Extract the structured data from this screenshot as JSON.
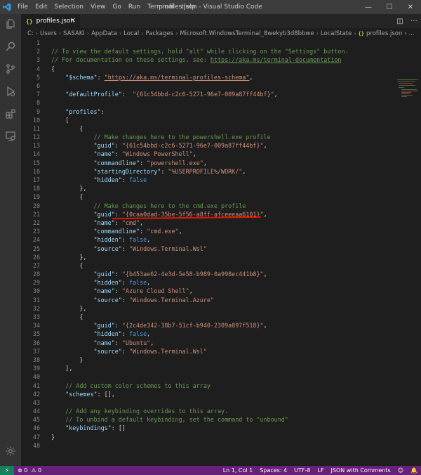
{
  "titlebar": {
    "menu": [
      "File",
      "Edit",
      "Selection",
      "View",
      "Go",
      "Run",
      "Terminal",
      "Help"
    ],
    "title": "profiles.json - Visual Studio Code",
    "minimize": "—",
    "maximize": "☐",
    "close": "✕"
  },
  "tab": {
    "icon": "{}",
    "label": "profiles.json",
    "close": "✕"
  },
  "editor_actions": {
    "split": "◫",
    "more": "···"
  },
  "breadcrumb": {
    "sep": "›",
    "items": [
      "C:",
      "Users",
      "SASAKI",
      "AppData",
      "Local",
      "Packages",
      "Microsoft.WindowsTerminal_8wekyb3d8bbwe",
      "LocalState"
    ],
    "file_icon": "{}",
    "file": "profiles.json",
    "trail": "› ..."
  },
  "code_lines": [
    {
      "n": "1",
      "segs": [
        {
          "t": "",
          "c": "c-punc"
        }
      ]
    },
    {
      "n": "2",
      "segs": [
        {
          "t": "// To view the default settings, hold \"alt\" while clicking on the \"Settings\" button.",
          "c": "c-comment"
        }
      ]
    },
    {
      "n": "3",
      "segs": [
        {
          "t": "// For documentation on these settings, see: ",
          "c": "c-comment"
        },
        {
          "t": "https://aka.ms/terminal-documentation",
          "c": "c-comment c-link"
        }
      ]
    },
    {
      "n": "4",
      "segs": [
        {
          "t": "{",
          "c": "c-punc"
        }
      ]
    },
    {
      "n": "5",
      "segs": [
        {
          "t": "    ",
          "c": "c-punc"
        },
        {
          "t": "\"$schema\"",
          "c": "c-key"
        },
        {
          "t": ": ",
          "c": "c-punc"
        },
        {
          "t": "\"https://aka.ms/terminal-profiles-schema\"",
          "c": "c-str c-link"
        },
        {
          "t": ",",
          "c": "c-punc"
        }
      ]
    },
    {
      "n": "6",
      "segs": [
        {
          "t": "",
          "c": "c-punc"
        }
      ]
    },
    {
      "n": "7",
      "segs": [
        {
          "t": "    ",
          "c": "c-punc"
        },
        {
          "t": "\"defaultProfile\"",
          "c": "c-key"
        },
        {
          "t": ":  ",
          "c": "c-punc"
        },
        {
          "t": "\"{61c54bbd-c2c6-5271-96e7-009a87ff44bf}\"",
          "c": "c-str"
        },
        {
          "t": ",",
          "c": "c-punc"
        }
      ]
    },
    {
      "n": "8",
      "segs": [
        {
          "t": "",
          "c": "c-punc"
        }
      ]
    },
    {
      "n": "9",
      "segs": [
        {
          "t": "    ",
          "c": "c-punc"
        },
        {
          "t": "\"profiles\"",
          "c": "c-key"
        },
        {
          "t": ":",
          "c": "c-punc"
        }
      ]
    },
    {
      "n": "10",
      "segs": [
        {
          "t": "    [",
          "c": "c-punc"
        }
      ]
    },
    {
      "n": "11",
      "segs": [
        {
          "t": "        {",
          "c": "c-punc"
        }
      ]
    },
    {
      "n": "12",
      "segs": [
        {
          "t": "            // Make changes here to the powershell.exe profile",
          "c": "c-comment"
        }
      ]
    },
    {
      "n": "13",
      "segs": [
        {
          "t": "            ",
          "c": "c-punc"
        },
        {
          "t": "\"guid\"",
          "c": "c-key"
        },
        {
          "t": ": ",
          "c": "c-punc"
        },
        {
          "t": "\"{61c54bbd-c2c6-5271-96e7-009a87ff44bf}\"",
          "c": "c-str"
        },
        {
          "t": ",",
          "c": "c-punc"
        }
      ]
    },
    {
      "n": "14",
      "segs": [
        {
          "t": "            ",
          "c": "c-punc"
        },
        {
          "t": "\"name\"",
          "c": "c-key"
        },
        {
          "t": ": ",
          "c": "c-punc"
        },
        {
          "t": "\"Windows PowerShell\"",
          "c": "c-str"
        },
        {
          "t": ",",
          "c": "c-punc"
        }
      ]
    },
    {
      "n": "15",
      "segs": [
        {
          "t": "            ",
          "c": "c-punc"
        },
        {
          "t": "\"commandline\"",
          "c": "c-key"
        },
        {
          "t": ": ",
          "c": "c-punc"
        },
        {
          "t": "\"powershell.exe\"",
          "c": "c-str"
        },
        {
          "t": ",",
          "c": "c-punc"
        }
      ]
    },
    {
      "n": "16",
      "segs": [
        {
          "t": "            ",
          "c": "c-punc"
        },
        {
          "t": "\"startingDirectory\"",
          "c": "c-key"
        },
        {
          "t": ": ",
          "c": "c-punc"
        },
        {
          "t": "\"%USERPROFILE%/WORK/\"",
          "c": "c-str"
        },
        {
          "t": ",",
          "c": "c-punc"
        }
      ]
    },
    {
      "n": "17",
      "segs": [
        {
          "t": "            ",
          "c": "c-punc"
        },
        {
          "t": "\"hidden\"",
          "c": "c-key"
        },
        {
          "t": ": ",
          "c": "c-punc"
        },
        {
          "t": "false",
          "c": "c-kw"
        }
      ]
    },
    {
      "n": "18",
      "segs": [
        {
          "t": "        },",
          "c": "c-punc"
        }
      ]
    },
    {
      "n": "19",
      "segs": [
        {
          "t": "        {",
          "c": "c-punc"
        }
      ]
    },
    {
      "n": "20",
      "segs": [
        {
          "t": "            // Make changes here to the cmd.exe profile",
          "c": "c-comment"
        }
      ]
    },
    {
      "n": "21",
      "segs": [
        {
          "t": "            ",
          "c": "c-punc"
        },
        {
          "t": "\"guid\"",
          "c": "c-key"
        },
        {
          "t": ": ",
          "c": "c-punc"
        },
        {
          "t": "\"{0caa0dad-35be-5f56-a8ff-afceeeaa6101}\"",
          "c": "c-str"
        },
        {
          "t": ",",
          "c": "c-punc"
        }
      ]
    },
    {
      "n": "22",
      "segs": [
        {
          "t": "            ",
          "c": "c-punc"
        },
        {
          "t": "\"name\"",
          "c": "c-key"
        },
        {
          "t": ": ",
          "c": "c-punc"
        },
        {
          "t": "\"cmd\"",
          "c": "c-str"
        },
        {
          "t": ",",
          "c": "c-punc"
        }
      ]
    },
    {
      "n": "23",
      "segs": [
        {
          "t": "            ",
          "c": "c-punc"
        },
        {
          "t": "\"commandline\"",
          "c": "c-key"
        },
        {
          "t": ": ",
          "c": "c-punc"
        },
        {
          "t": "\"cmd.exe\"",
          "c": "c-str"
        },
        {
          "t": ",",
          "c": "c-punc"
        }
      ]
    },
    {
      "n": "24",
      "segs": [
        {
          "t": "            ",
          "c": "c-punc"
        },
        {
          "t": "\"hidden\"",
          "c": "c-key"
        },
        {
          "t": ": ",
          "c": "c-punc"
        },
        {
          "t": "false",
          "c": "c-kw"
        },
        {
          "t": ",",
          "c": "c-punc"
        }
      ]
    },
    {
      "n": "25",
      "segs": [
        {
          "t": "            ",
          "c": "c-punc"
        },
        {
          "t": "\"source\"",
          "c": "c-key"
        },
        {
          "t": ": ",
          "c": "c-punc"
        },
        {
          "t": "\"Windows.Terminal.Wsl\"",
          "c": "c-str"
        }
      ]
    },
    {
      "n": "26",
      "segs": [
        {
          "t": "        },",
          "c": "c-punc"
        }
      ]
    },
    {
      "n": "27",
      "segs": [
        {
          "t": "        {",
          "c": "c-punc"
        }
      ]
    },
    {
      "n": "28",
      "segs": [
        {
          "t": "            ",
          "c": "c-punc"
        },
        {
          "t": "\"guid\"",
          "c": "c-key"
        },
        {
          "t": ": ",
          "c": "c-punc"
        },
        {
          "t": "\"{b453ae62-4e3d-5e58-b989-0a998ec441b8}\"",
          "c": "c-str"
        },
        {
          "t": ",",
          "c": "c-punc"
        }
      ]
    },
    {
      "n": "29",
      "segs": [
        {
          "t": "            ",
          "c": "c-punc"
        },
        {
          "t": "\"hidden\"",
          "c": "c-key"
        },
        {
          "t": ": ",
          "c": "c-punc"
        },
        {
          "t": "false",
          "c": "c-kw"
        },
        {
          "t": ",",
          "c": "c-punc"
        }
      ]
    },
    {
      "n": "30",
      "segs": [
        {
          "t": "            ",
          "c": "c-punc"
        },
        {
          "t": "\"name\"",
          "c": "c-key"
        },
        {
          "t": ": ",
          "c": "c-punc"
        },
        {
          "t": "\"Azure Cloud Shell\"",
          "c": "c-str"
        },
        {
          "t": ",",
          "c": "c-punc"
        }
      ]
    },
    {
      "n": "31",
      "segs": [
        {
          "t": "            ",
          "c": "c-punc"
        },
        {
          "t": "\"source\"",
          "c": "c-key"
        },
        {
          "t": ": ",
          "c": "c-punc"
        },
        {
          "t": "\"Windows.Terminal.Azure\"",
          "c": "c-str"
        }
      ]
    },
    {
      "n": "32",
      "segs": [
        {
          "t": "        },",
          "c": "c-punc"
        }
      ]
    },
    {
      "n": "33",
      "segs": [
        {
          "t": "        {",
          "c": "c-punc"
        }
      ]
    },
    {
      "n": "34",
      "segs": [
        {
          "t": "            ",
          "c": "c-punc"
        },
        {
          "t": "\"guid\"",
          "c": "c-key"
        },
        {
          "t": ": ",
          "c": "c-punc"
        },
        {
          "t": "\"{2c4de342-38b7-51cf-b940-2309a097f518}\"",
          "c": "c-str"
        },
        {
          "t": ",",
          "c": "c-punc"
        }
      ]
    },
    {
      "n": "35",
      "segs": [
        {
          "t": "            ",
          "c": "c-punc"
        },
        {
          "t": "\"hidden\"",
          "c": "c-key"
        },
        {
          "t": ": ",
          "c": "c-punc"
        },
        {
          "t": "false",
          "c": "c-kw"
        },
        {
          "t": ",",
          "c": "c-punc"
        }
      ]
    },
    {
      "n": "36",
      "segs": [
        {
          "t": "            ",
          "c": "c-punc"
        },
        {
          "t": "\"name\"",
          "c": "c-key"
        },
        {
          "t": ": ",
          "c": "c-punc"
        },
        {
          "t": "\"Ubuntu\"",
          "c": "c-str"
        },
        {
          "t": ",",
          "c": "c-punc"
        }
      ]
    },
    {
      "n": "37",
      "segs": [
        {
          "t": "            ",
          "c": "c-punc"
        },
        {
          "t": "\"source\"",
          "c": "c-key"
        },
        {
          "t": ": ",
          "c": "c-punc"
        },
        {
          "t": "\"Windows.Terminal.Wsl\"",
          "c": "c-str"
        }
      ]
    },
    {
      "n": "38",
      "segs": [
        {
          "t": "        }",
          "c": "c-punc"
        }
      ]
    },
    {
      "n": "39",
      "segs": [
        {
          "t": "    ],",
          "c": "c-punc"
        }
      ]
    },
    {
      "n": "40",
      "segs": [
        {
          "t": "",
          "c": "c-punc"
        }
      ]
    },
    {
      "n": "41",
      "segs": [
        {
          "t": "    // Add custom color schemes to this array",
          "c": "c-comment"
        }
      ]
    },
    {
      "n": "42",
      "segs": [
        {
          "t": "    ",
          "c": "c-punc"
        },
        {
          "t": "\"schemes\"",
          "c": "c-key"
        },
        {
          "t": ": [],",
          "c": "c-punc"
        }
      ]
    },
    {
      "n": "43",
      "segs": [
        {
          "t": "",
          "c": "c-punc"
        }
      ]
    },
    {
      "n": "44",
      "segs": [
        {
          "t": "    // Add any keybinding overrides to this array.",
          "c": "c-comment"
        }
      ]
    },
    {
      "n": "45",
      "segs": [
        {
          "t": "    // To unbind a default keybinding, set the command to \"unbound\"",
          "c": "c-comment"
        }
      ]
    },
    {
      "n": "46",
      "segs": [
        {
          "t": "    ",
          "c": "c-punc"
        },
        {
          "t": "\"keybindings\"",
          "c": "c-key"
        },
        {
          "t": ": []",
          "c": "c-punc"
        }
      ]
    },
    {
      "n": "47",
      "segs": [
        {
          "t": "}",
          "c": "c-punc"
        }
      ]
    },
    {
      "n": "48",
      "segs": [
        {
          "t": "",
          "c": "c-punc"
        }
      ]
    }
  ],
  "statusbar": {
    "remote_icon": "⚡",
    "errors": "⊗ 0",
    "warnings": "⚠ 0",
    "position": "Ln 1, Col 1",
    "spaces": "Spaces: 4",
    "encoding": "UTF-8",
    "eol": "LF",
    "language": "JSON with Comments",
    "feedback_icon": "☺",
    "bell_icon": "🔔"
  },
  "colors": {
    "statusbar": "#68217a",
    "remote": "#16825d",
    "comment": "#6a9955",
    "key": "#9cdcfe",
    "string": "#ce9178",
    "keyword": "#569cd6",
    "annotation": "#e51400"
  }
}
